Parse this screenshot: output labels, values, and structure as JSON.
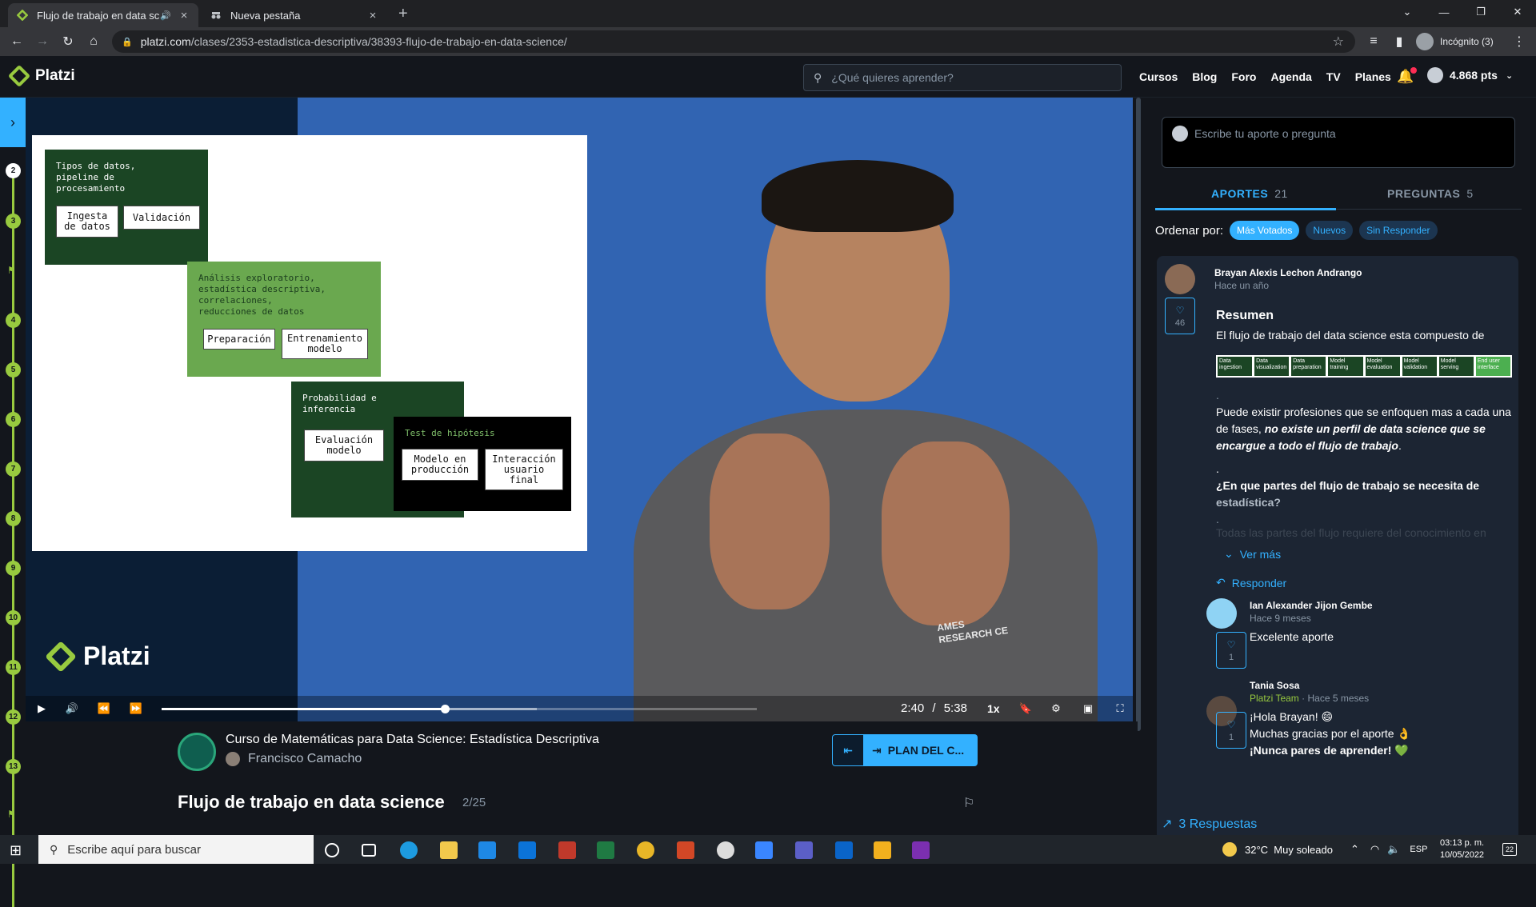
{
  "browser": {
    "tabs": [
      {
        "title": "Flujo de trabajo en data scie",
        "favicon": "platzi-icon"
      },
      {
        "title": "Nueva pestaña",
        "favicon": "incognito-icon"
      }
    ],
    "url_host": "platzi.com",
    "url_path": "/clases/2353-estadistica-descriptiva/38393-flujo-de-trabajo-en-data-science/",
    "incognito_label": "Incógnito (3)"
  },
  "header": {
    "brand": "Platzi",
    "search_placeholder": "¿Qué quieres aprender?",
    "nav": [
      "Cursos",
      "Blog",
      "Foro",
      "Agenda",
      "TV",
      "Planes"
    ],
    "points": "4.868 pts"
  },
  "rail": {
    "items": [
      "2",
      "3",
      "4",
      "5",
      "6",
      "7",
      "8",
      "9",
      "10",
      "11",
      "12",
      "13"
    ]
  },
  "slide": {
    "block1_title": "Tipos de datos,\npipeline de\nprocesamiento",
    "block1_a": "Ingesta\nde datos",
    "block1_b": "Validación",
    "block2_title": "Análisis exploratorio,\nestadística descriptiva,\ncorrelaciones,\nreducciones de datos",
    "block2_a": "Preparación",
    "block2_b": "Entrenamiento\nmodelo",
    "block3_title": "Probabilidad e\ninferencia",
    "block3_a": "Evaluación\nmodelo",
    "block4_title": "Test de hipótesis",
    "block4_a": "Modelo en\nproducción",
    "block4_b": "Interacción\nusuario\nfinal"
  },
  "video": {
    "watermark": "Platzi",
    "shirt_text": "AMES\nRESEARCH CE",
    "current_time": "2:40",
    "separator": "/",
    "duration": "5:38",
    "speed": "1x",
    "progress": 0.476,
    "buffered": 0.63
  },
  "course": {
    "title": "Curso de Matemáticas para Data Science: Estadística Descriptiva",
    "teacher": "Francisco Camacho",
    "plan_button": "PLAN DEL C...",
    "lesson_title": "Flujo de trabajo en data science",
    "lesson_index": "2/25"
  },
  "sidebar": {
    "ask_placeholder": "Escribe tu aporte o pregunta",
    "tabs": [
      {
        "label": "APORTES",
        "count": "21"
      },
      {
        "label": "PREGUNTAS",
        "count": "5"
      }
    ],
    "sort_label": "Ordenar por:",
    "sort_options": [
      "Más Votados",
      "Nuevos",
      "Sin Responder"
    ],
    "post": {
      "author": "Brayan Alexis Lechon Andrango",
      "time": "Hace un año",
      "likes": "46",
      "title": "Resumen",
      "intro": "El flujo de trabajo del data science esta compuesto de",
      "flow": [
        "Data ingestion",
        "Data visualization",
        "Data preparation",
        "Model training",
        "Model evaluation",
        "Model validation",
        "Model serving",
        "End user interface"
      ],
      "dot1": ".",
      "p1_a": "Puede existir profesiones que se enfoquen mas a cada una de fases, ",
      "p1_b": "no existe un perfil de data science que se encargue a todo el flujo de trabajo",
      "p1_c": ".",
      "dot2": ".",
      "question": "¿En que partes del flujo de trabajo se necesita de ",
      "question_b": "estadística?",
      "dot3": ".",
      "faded": "Todas las partes del flujo requiere del conocimiento en",
      "ver_mas": "Ver más",
      "responder": "Responder"
    },
    "replies": [
      {
        "author": "Ian Alexander Jijon Gembe",
        "time": "Hace 9 meses",
        "likes": "1",
        "text": "Excelente aporte"
      },
      {
        "author": "Tania Sosa",
        "team": "Platzi Team",
        "time": "Hace 5 meses",
        "likes": "1",
        "line1": "¡Hola Brayan! 😄",
        "line2": "Muchas gracias por el aporte 👌",
        "line3": "¡Nunca pares de aprender! 💚"
      }
    ],
    "respuestas": "3 Respuestas"
  },
  "taskbar": {
    "search_placeholder": "Escribe aquí para buscar",
    "weather": "32°C  Muy soleado",
    "lang": "ESP",
    "time": "03:13 p. m.",
    "date": "10/05/2022",
    "notifications": "22"
  },
  "colors": {
    "accent": "#33b1ff",
    "brand_green": "#98ca3f",
    "bg": "#13161c"
  }
}
